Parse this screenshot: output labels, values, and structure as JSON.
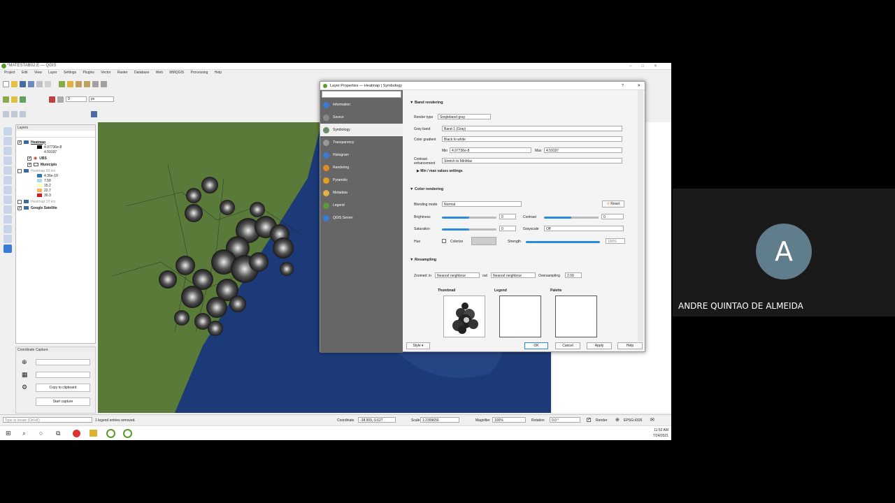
{
  "window": {
    "title": "*MATESTAB02.E — QGIS"
  },
  "menu": [
    "Project",
    "Edit",
    "View",
    "Layer",
    "Settings",
    "Plugins",
    "Vector",
    "Raster",
    "Database",
    "Web",
    "MMQGIS",
    "Processing",
    "Help"
  ],
  "toolbar": {
    "zoom_value": "9",
    "unit": "px"
  },
  "layers_panel": {
    "title": "Layers",
    "items": [
      {
        "name": "Heatmap",
        "checked": true
      },
      {
        "name": "4.97736e-8",
        "color": "#000000"
      },
      {
        "name": "4.59197",
        "color": "#ffffff"
      },
      {
        "name": "UBS",
        "checked": true
      },
      {
        "name": "Municipio",
        "checked": true
      },
      {
        "name": "Heatmap 50 km",
        "checked": false
      },
      {
        "name": "4.36e-10",
        "color": "#2c7bb6"
      },
      {
        "name": "7.58",
        "color": "#abd9e9"
      },
      {
        "name": "15.2",
        "color": "#ffffbf"
      },
      {
        "name": "22.7",
        "color": "#fdae61"
      },
      {
        "name": "30.3",
        "color": "#d7191c"
      },
      {
        "name": "Heatmap 10 km",
        "checked": false
      },
      {
        "name": "Google Satellite",
        "checked": true
      }
    ]
  },
  "coordinate_capture": {
    "title": "Coordinate Capture",
    "copy_label": "Copy to clipboard",
    "start_label": "Start capture"
  },
  "dialog": {
    "title": "Layer Properties — Heatmap | Symbology",
    "help": "?",
    "close": "✕",
    "search_placeholder": "",
    "nav": [
      {
        "label": "Information",
        "color": "#3a7bd5"
      },
      {
        "label": "Source",
        "color": "#888888"
      },
      {
        "label": "Symbology",
        "color": "#6a8a6a",
        "selected": true
      },
      {
        "label": "Transparency",
        "color": "#999999"
      },
      {
        "label": "Histogram",
        "color": "#3a7bd5"
      },
      {
        "label": "Rendering",
        "color": "#e08a2a"
      },
      {
        "label": "Pyramids",
        "color": "#e0a020"
      },
      {
        "label": "Metadata",
        "color": "#e0b040"
      },
      {
        "label": "Legend",
        "color": "#5a9a3a"
      },
      {
        "label": "QGIS Server",
        "color": "#3a7bd5"
      }
    ],
    "band_rendering": {
      "title": "Band rendering",
      "render_type_label": "Render type",
      "render_type": "Singleband gray",
      "gray_band_label": "Gray band",
      "gray_band": "Band 1 (Gray)",
      "gradient_label": "Color gradient",
      "gradient": "Black to white",
      "min_label": "Min",
      "min": "4.97736e-8",
      "max_label": "Max",
      "max": "4.59197",
      "contrast_label": "Contrast enhancement",
      "contrast": "Stretch to MinMax",
      "minmax_settings": "Min / max values settings"
    },
    "color_rendering": {
      "title": "Color rendering",
      "blending_label": "Blending mode",
      "blending": "Normal",
      "reset": "Reset",
      "brightness_label": "Brightness",
      "brightness": "0",
      "contrast_label": "Contrast",
      "contrast": "0",
      "saturation_label": "Saturation",
      "saturation": "0",
      "grayscale_label": "Grayscale",
      "grayscale": "Off",
      "hue_label": "Hue",
      "colorize_label": "Colorize",
      "strength_label": "Strength",
      "strength": "100%"
    },
    "resampling": {
      "title": "Resampling",
      "zoomed_in_label": "Zoomed: in",
      "zoomed_in": "Nearest neighbour",
      "out_label": "out",
      "out": "Nearest neighbour",
      "oversampling_label": "Oversampling",
      "oversampling": "2.00"
    },
    "previews": {
      "thumbnail": "Thumbnail",
      "legend": "Legend",
      "palette": "Palette"
    },
    "buttons": {
      "style": "Style",
      "ok": "OK",
      "cancel": "Cancel",
      "apply": "Apply",
      "help": "Help"
    }
  },
  "statusbar": {
    "locate_placeholder": "Type to locate (Ctrl+K)",
    "message": "1 legend entries removed.",
    "coordinate_label": "Coordinate",
    "coordinate": "-38.909,-9.627",
    "scale_label": "Scale",
    "scale": "1:2399656",
    "magnifier_label": "Magnifier",
    "magnifier": "100%",
    "rotation_label": "Rotation",
    "rotation": "0.0 °",
    "render_label": "Render",
    "crs": "EPSG:4326"
  },
  "taskbar": {
    "time": "11:52 AM",
    "date": "7/24/2021"
  },
  "participant": {
    "initial": "A",
    "name": "ANDRE QUINTAO DE ALMEIDA"
  }
}
